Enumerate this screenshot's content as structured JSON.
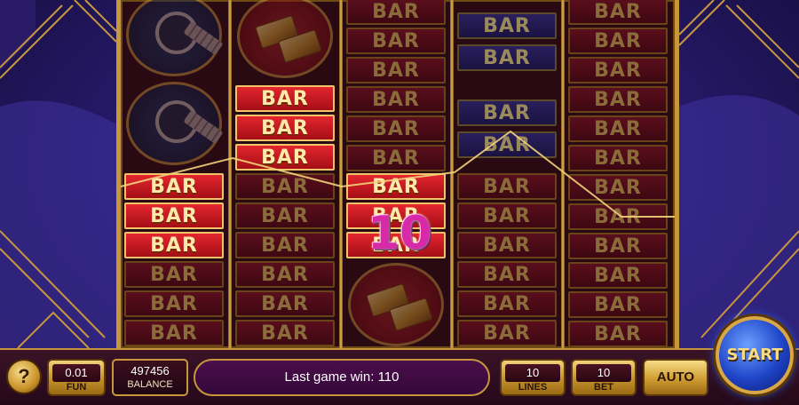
{
  "game": {
    "symbol_bar": "BAR",
    "win_amount": "10"
  },
  "controls": {
    "help_label": "?",
    "coin_value": "0.01",
    "coin_label": "FUN",
    "balance_value": "497456",
    "balance_label": "BALANCE",
    "status_text": "Last game win: 110",
    "lines_value": "10",
    "lines_label": "LINES",
    "bet_value": "10",
    "bet_label": "BET",
    "auto_label": "AUTO",
    "start_label": "START"
  },
  "colors": {
    "frame_gold": "#c9973b",
    "start_blue": "#1f44c8",
    "win_magenta": "#d82aa8"
  }
}
